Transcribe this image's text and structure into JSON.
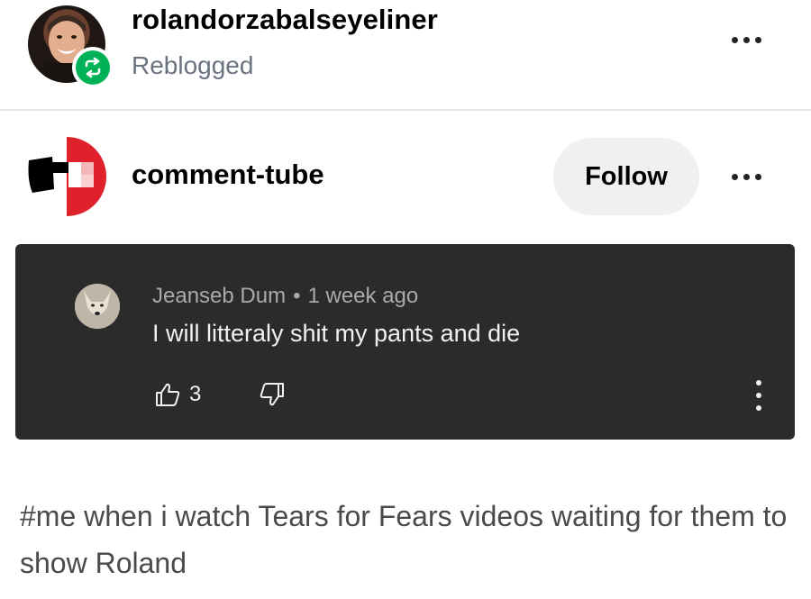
{
  "reblogger": {
    "username": "rolandorzabalseyeliner",
    "status": "Reblogged",
    "avatar_icon": "person-photo",
    "badge_icon": "reblog-icon",
    "badge_color": "#00b257"
  },
  "post": {
    "blog_name": "comment-tube",
    "follow_label": "Follow",
    "avatar_icon": "youtube-style-logo"
  },
  "comment": {
    "author": "Jeanseb Dum",
    "separator": "•",
    "time": "1 week ago",
    "text": "I will litteraly shit my pants and die",
    "likes": "3",
    "background": "#2b2b2b"
  },
  "caption": "#me when i watch Tears for Fears videos waiting for them to show Roland"
}
